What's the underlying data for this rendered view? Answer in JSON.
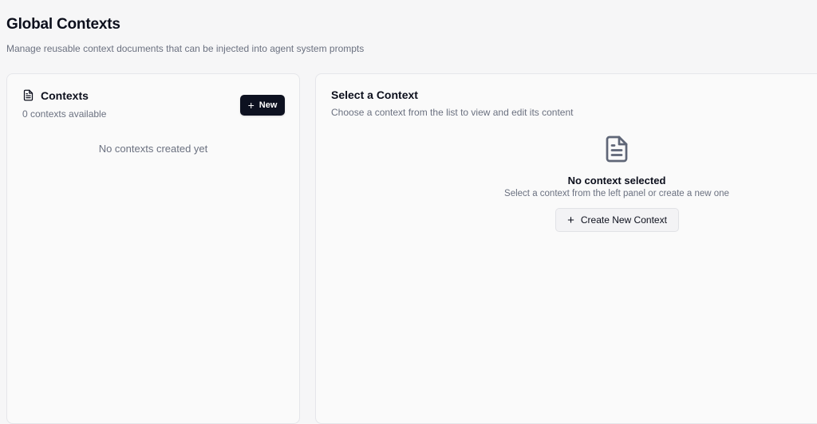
{
  "page": {
    "title": "Global Contexts",
    "subtitle": "Manage reusable context documents that can be injected into agent system prompts"
  },
  "left_panel": {
    "icon": "document-icon",
    "title": "Contexts",
    "count_text": "0 contexts available",
    "new_button_label": "New",
    "empty_text": "No contexts created yet"
  },
  "right_panel": {
    "title": "Select a Context",
    "subtitle": "Choose a context from the list to view and edit its content",
    "icon": "document-icon",
    "empty_title": "No context selected",
    "empty_subtitle": "Select a context from the left panel or create a new one",
    "create_button_label": "Create New Context"
  },
  "colors": {
    "background": "#f6f6f7",
    "primary_button": "#0d1120",
    "muted_text": "#6b7180",
    "icon": "#5f6677"
  }
}
